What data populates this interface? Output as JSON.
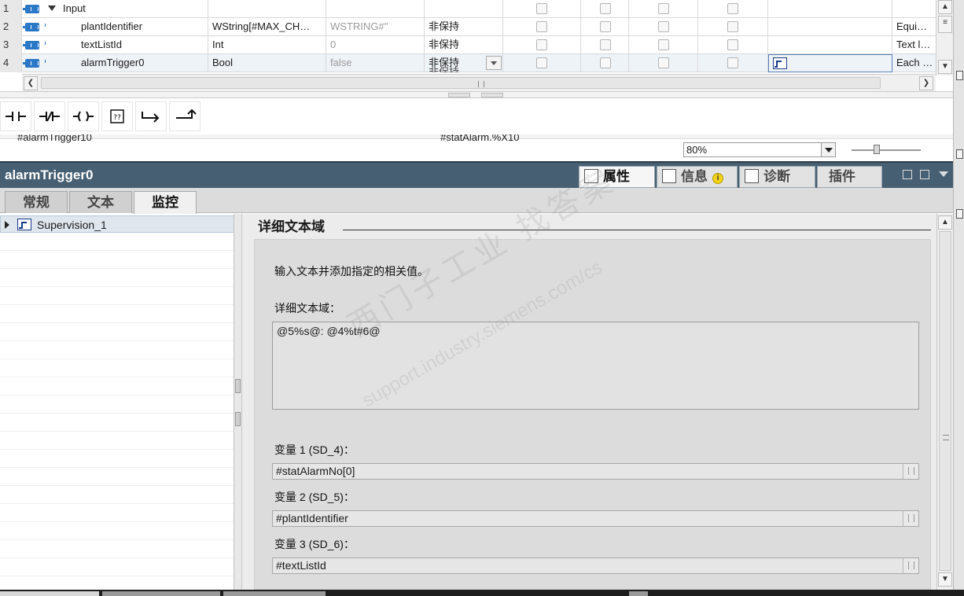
{
  "table": {
    "rows": [
      {
        "num": "1",
        "name": "Input",
        "type": "",
        "default": "",
        "retain": "",
        "supervision": "",
        "comment": ""
      },
      {
        "num": "2",
        "name": "plantIdentifier",
        "type": "WString[#MAX_CH…",
        "default": "WSTRING#''",
        "retain": "非保持",
        "supervision": "",
        "comment": "Equi…"
      },
      {
        "num": "3",
        "name": "textListId",
        "type": "Int",
        "default": "0",
        "retain": "非保持",
        "supervision": "",
        "comment": "Text l…"
      },
      {
        "num": "4",
        "name": "alarmTrigger0",
        "type": "Bool",
        "default": "false",
        "retain": "非保持",
        "supervision": "",
        "comment": "Each …"
      }
    ],
    "next_row_retain_partial": "非保持"
  },
  "network_peek": {
    "left_text": "#alarmTrigger10",
    "right_text": "#statAlarm.%X10"
  },
  "zoom": {
    "value": "80%"
  },
  "inspector": {
    "title": "alarmTrigger0",
    "tabs": [
      {
        "label": "属性"
      },
      {
        "label": "信息"
      },
      {
        "label": "诊断"
      },
      {
        "label": "插件"
      }
    ],
    "info_badge": "i",
    "subtabs": [
      {
        "label": "常规"
      },
      {
        "label": "文本"
      },
      {
        "label": "监控"
      }
    ]
  },
  "tree": {
    "items": [
      {
        "label": "Supervision_1"
      }
    ]
  },
  "content": {
    "section_title": "详细文本域",
    "instruction": "输入文本并添加指定的相关值。",
    "detail_label": "详细文本域：",
    "detail_value": "@5%s@: @4%t#6@",
    "variables": [
      {
        "label": "变量 1 (SD_4)：",
        "value": "#statAlarmNo[0]"
      },
      {
        "label": "变量 2 (SD_5)：",
        "value": "#plantIdentifier"
      },
      {
        "label": "变量 3 (SD_6)：",
        "value": "#textListId"
      }
    ]
  },
  "watermark": {
    "line1": "西门子工业  找答案",
    "line2": "support.industry.siemens.com/cs"
  }
}
